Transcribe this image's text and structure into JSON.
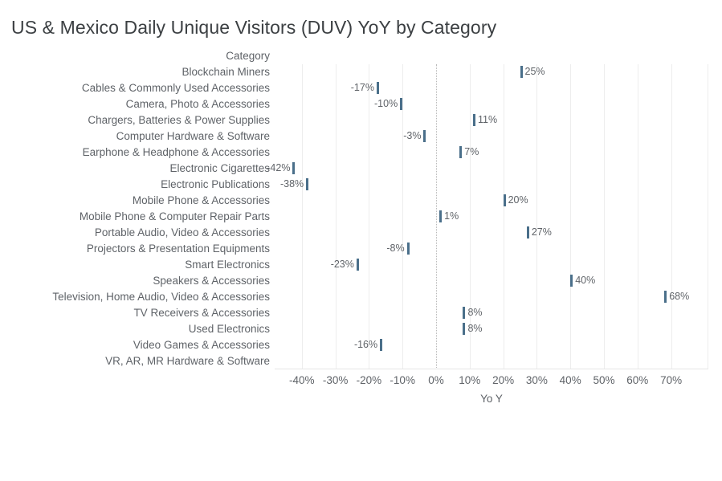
{
  "chart_data": {
    "type": "bar",
    "orientation": "horizontal",
    "title": "US & Mexico Daily Unique Visitors (DUV) YoY by Category",
    "category_axis_title": "Category",
    "xlabel": "Yo Y",
    "ylabel": "Category",
    "xlim": [
      -45,
      75
    ],
    "grid": true,
    "zero_line": true,
    "legend": "none",
    "bar_color": "#4a6f8a",
    "xticks": [
      {
        "value": -40,
        "label": "-40%"
      },
      {
        "value": -30,
        "label": "-30%"
      },
      {
        "value": -20,
        "label": "-20%"
      },
      {
        "value": -10,
        "label": "-10%"
      },
      {
        "value": 0,
        "label": "0%"
      },
      {
        "value": 10,
        "label": "10%"
      },
      {
        "value": 20,
        "label": "20%"
      },
      {
        "value": 30,
        "label": "30%"
      },
      {
        "value": 40,
        "label": "40%"
      },
      {
        "value": 50,
        "label": "50%"
      },
      {
        "value": 60,
        "label": "60%"
      },
      {
        "value": 70,
        "label": "70%"
      }
    ],
    "categories": [
      "Blockchain Miners",
      "Cables & Commonly Used Accessories",
      "Camera, Photo & Accessories",
      "Chargers, Batteries & Power Supplies",
      "Computer Hardware & Software",
      "Earphone & Headphone & Accessories",
      "Electronic Cigarettes",
      "Electronic Publications",
      "Mobile Phone & Accessories",
      "Mobile Phone & Computer Repair Parts",
      "Portable Audio, Video & Accessories",
      "Projectors & Presentation Equipments",
      "Smart Electronics",
      "Speakers & Accessories",
      "Television, Home Audio, Video & Accessories",
      "TV Receivers & Accessories",
      "Used Electronics",
      "Video Games & Accessories",
      "VR, AR, MR Hardware & Software"
    ],
    "values": [
      25,
      -17,
      -10,
      11,
      -3,
      7,
      -42,
      -38,
      20,
      1,
      27,
      -8,
      -23,
      40,
      68,
      8,
      8,
      -16,
      null
    ],
    "value_labels": [
      "25%",
      "-17%",
      "-10%",
      "11%",
      "-3%",
      "7%",
      "-42%",
      "-38%",
      "20%",
      "1%",
      "27%",
      "-8%",
      "-23%",
      "40%",
      "68%",
      "8%",
      "8%",
      "-16%",
      ""
    ]
  }
}
